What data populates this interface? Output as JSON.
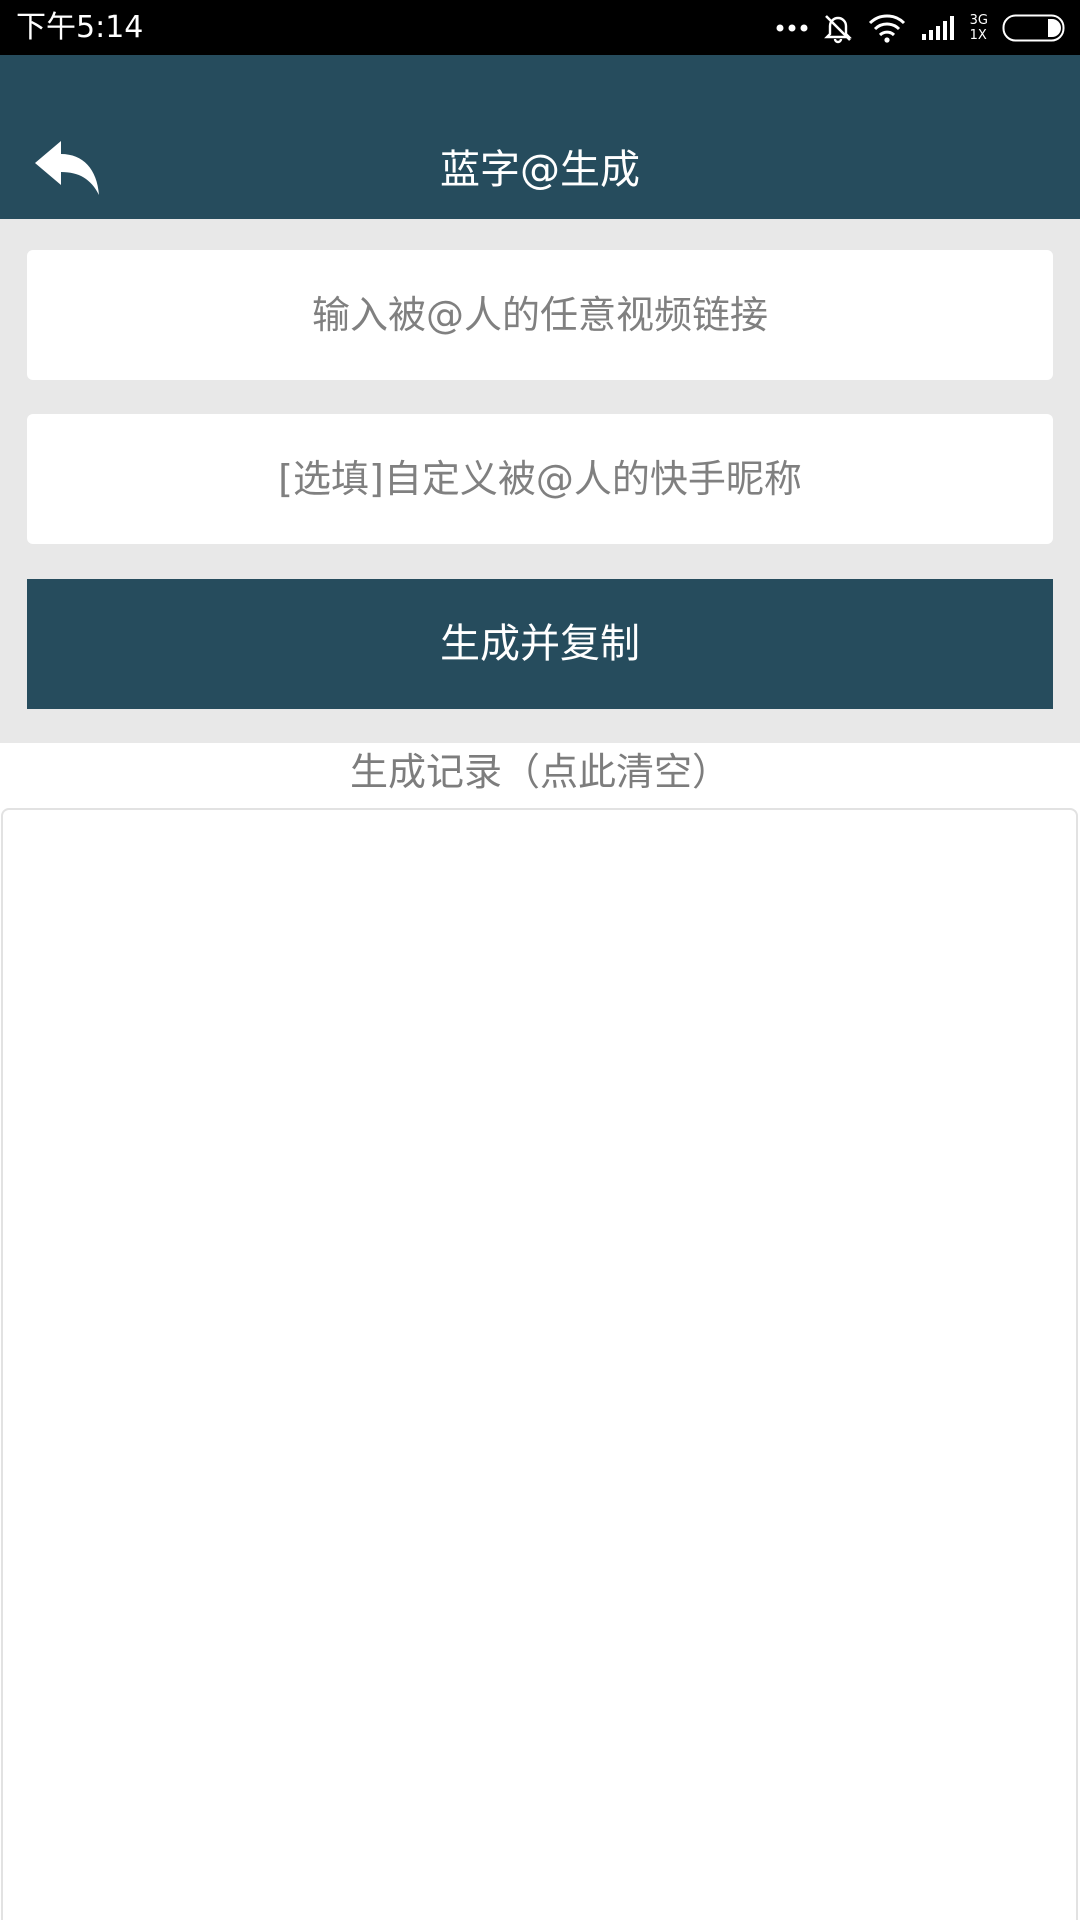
{
  "status_bar": {
    "time": "下午5:14",
    "network_top": "3G",
    "network_bottom": "1X"
  },
  "header": {
    "title": "蓝字@生成",
    "back_icon": "reply-arrow-icon",
    "background": "#264c5d"
  },
  "form": {
    "link_placeholder": "输入被@人的任意视频链接",
    "link_value": "",
    "nickname_placeholder": "[选填]自定义被@人的快手昵称",
    "nickname_value": "",
    "generate_label": "生成并复制"
  },
  "history": {
    "heading": "生成记录（点此清空）",
    "items": []
  }
}
